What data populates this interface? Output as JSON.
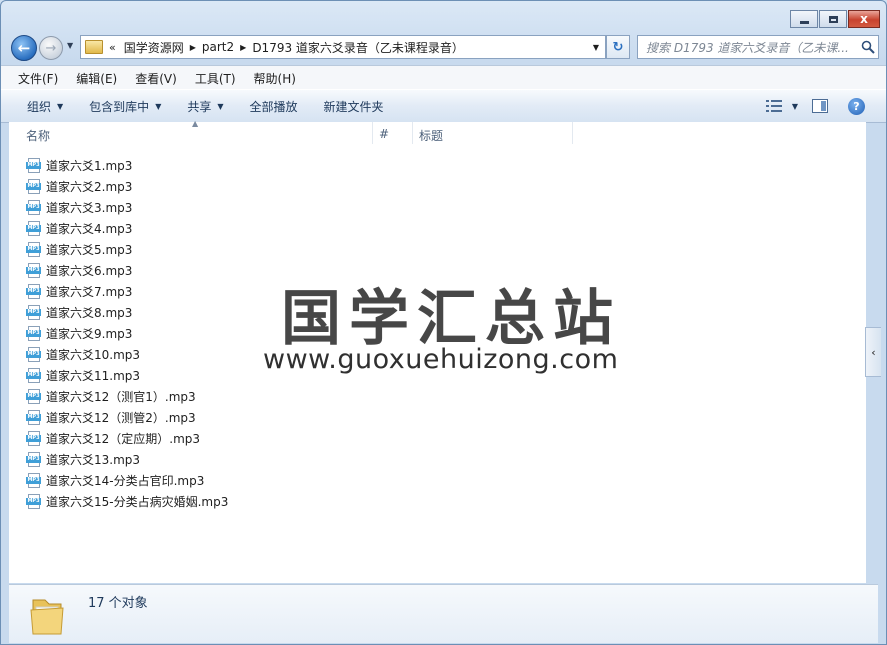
{
  "window": {
    "title_buttons": {
      "minimize": "",
      "maximize": "",
      "close": "x"
    }
  },
  "nav": {
    "back_glyph": "←",
    "forward_glyph": "→",
    "history_dropdown": "▼",
    "breadcrumb_overflow": "«",
    "breadcrumbs": [
      "国学资源网",
      "part2",
      "D1793 道家六爻录音（乙未课程录音）"
    ],
    "address_dropdown": "▼",
    "refresh_glyph": "↻",
    "search_placeholder": "搜索 D1793 道家六爻录音（乙未课..."
  },
  "menu": [
    "文件(F)",
    "编辑(E)",
    "查看(V)",
    "工具(T)",
    "帮助(H)"
  ],
  "commands": {
    "organize": "组织",
    "include_in_library": "包含到库中",
    "share": "共享",
    "play_all": "全部播放",
    "new_folder": "新建文件夹",
    "help_glyph": "?"
  },
  "columns": {
    "name": "名称",
    "number": "#",
    "title": "标题"
  },
  "files": [
    "道家六爻1.mp3",
    "道家六爻2.mp3",
    "道家六爻3.mp3",
    "道家六爻4.mp3",
    "道家六爻5.mp3",
    "道家六爻6.mp3",
    "道家六爻7.mp3",
    "道家六爻8.mp3",
    "道家六爻9.mp3",
    "道家六爻10.mp3",
    "道家六爻11.mp3",
    "道家六爻12（测官1）.mp3",
    "道家六爻12（测管2）.mp3",
    "道家六爻12（定应期）.mp3",
    "道家六爻13.mp3",
    "道家六爻14-分类占官印.mp3",
    "道家六爻15-分类占病灾婚姻.mp3"
  ],
  "file_icon_label": "MP3",
  "watermark": {
    "line1": "国学汇总站",
    "line2": "www.guoxuehuizong.com"
  },
  "side_pane_toggle": "‹",
  "status": {
    "item_count": "17 个对象"
  },
  "colors": {
    "accent": "#2a6fc0",
    "close": "#c8432f",
    "file_tag": "#3f9fd8"
  }
}
